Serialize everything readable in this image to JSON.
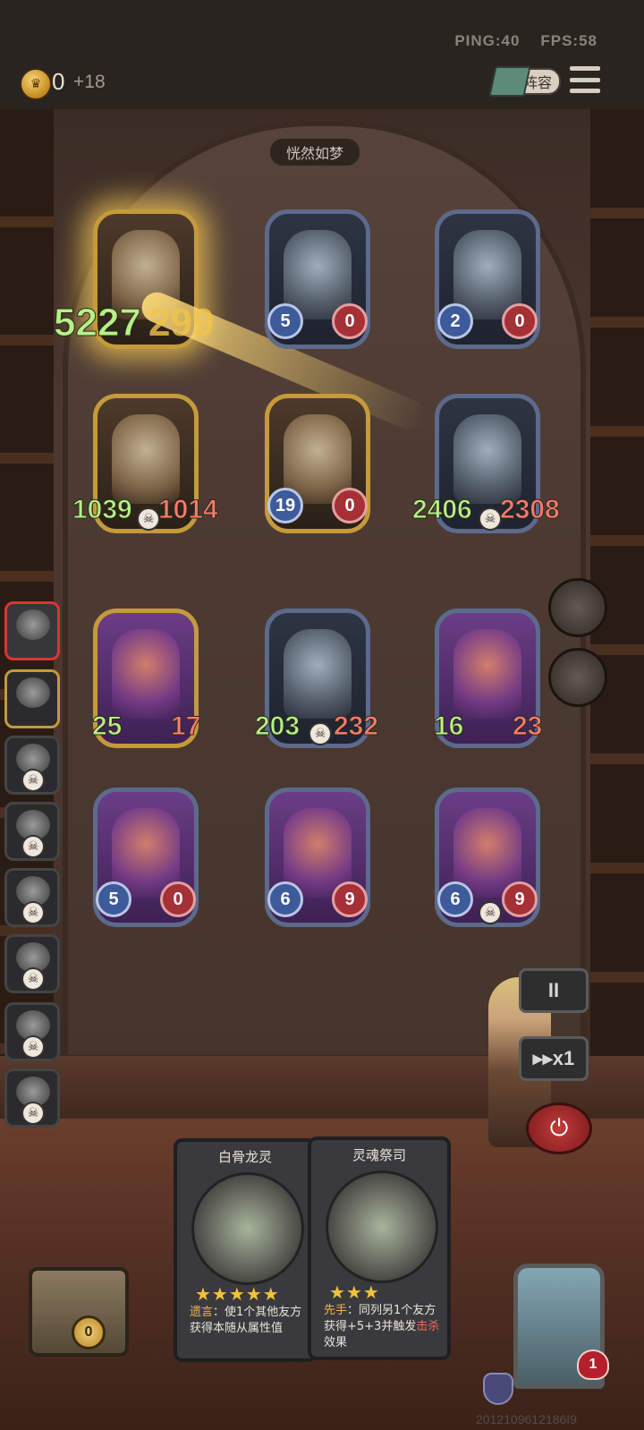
{
  "topbar": {
    "ping": "PING:40",
    "fps": "FPS:58",
    "gold": "0",
    "gold_income": "+18",
    "lineup_label": "阵容"
  },
  "board_title": "恍然如梦",
  "floating_damage": {
    "value": "5227",
    "overlay": "299"
  },
  "enemy_row": [
    {
      "atk": "",
      "hp": "",
      "state": "attacking"
    },
    {
      "atk": "5",
      "hp": "0"
    },
    {
      "atk": "2",
      "hp": "0"
    }
  ],
  "enemy_row2": [
    {
      "atk": "1039",
      "hp": "1014"
    },
    {
      "atk": "19",
      "hp": "0"
    },
    {
      "atk": "2406",
      "hp": "2308"
    }
  ],
  "player_row1": [
    {
      "atk": "25",
      "hp": "17"
    },
    {
      "atk": "203",
      "hp": "232"
    },
    {
      "atk": "16",
      "hp": "23"
    }
  ],
  "player_row2": [
    {
      "atk": "5",
      "hp": "0"
    },
    {
      "atk": "6",
      "hp": "9"
    },
    {
      "atk": "6",
      "hp": "9"
    }
  ],
  "controls": {
    "pause": "II",
    "speed": "▸▸x1",
    "power": "⏻"
  },
  "hand": [
    {
      "name": "白骨龙灵",
      "stars": "★★★★★",
      "text_kw": "遗言",
      "text": "：使1个其他友方获得本随从属性值"
    },
    {
      "name": "灵魂祭司",
      "stars": "★★★",
      "text_kw": "先手",
      "text": "：同列另1个友方获得+5+3并触发",
      "text_kw2": "击杀",
      "text_tail": "效果"
    }
  ],
  "chest_coin": "0",
  "player": {
    "hp": "1"
  },
  "id_text": "2012109612186I9",
  "colors": {
    "accent_gold": "#c59a3d",
    "atk_blue": "#3d5a9a",
    "hp_red": "#a53036",
    "heal_green": "#b6f08a"
  }
}
